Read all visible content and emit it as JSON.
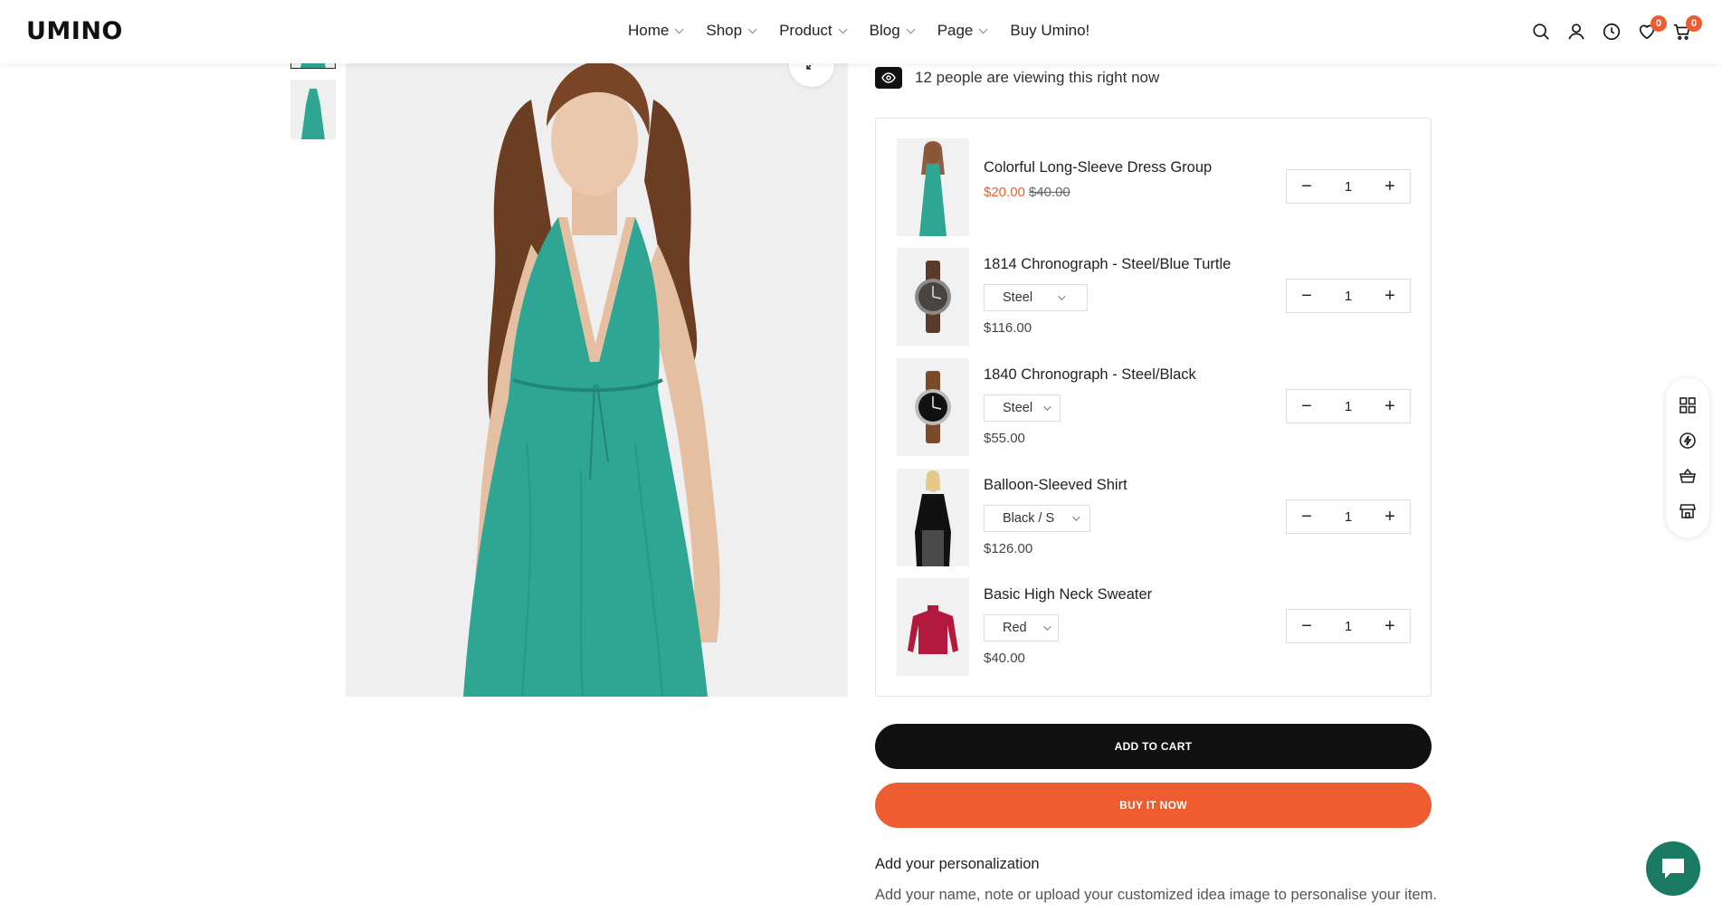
{
  "header": {
    "logo": "UMINO",
    "nav": [
      {
        "label": "Home",
        "dropdown": true
      },
      {
        "label": "Shop",
        "dropdown": true
      },
      {
        "label": "Product",
        "dropdown": true
      },
      {
        "label": "Blog",
        "dropdown": true
      },
      {
        "label": "Page",
        "dropdown": true
      },
      {
        "label": "Buy Umino!",
        "dropdown": false
      }
    ],
    "icons": [
      "search-icon",
      "account-icon",
      "history-icon",
      "wishlist-icon",
      "cart-icon"
    ],
    "wishlist_count": "0",
    "cart_count": "0"
  },
  "gallery": {
    "thumbnails": [
      "dress-front",
      "dress-back"
    ],
    "active_thumbnail": 0
  },
  "product": {
    "viewers_text": "12 people are viewing this right now"
  },
  "bundle": {
    "items": [
      {
        "name": "Colorful Long-Sleeve Dress Group",
        "sale_price": "$20.00",
        "old_price": "$40.00",
        "variant": null,
        "qty": "1",
        "image": "dress"
      },
      {
        "name": "1814 Chronograph - Steel/Blue Turtle",
        "price": "$116.00",
        "variant": "Steel",
        "qty": "1",
        "image": "watch-brown"
      },
      {
        "name": "1840 Chronograph - Steel/Black",
        "price": "$55.00",
        "variant": "Steel",
        "qty": "1",
        "image": "watch-black"
      },
      {
        "name": "Balloon-Sleeved Shirt",
        "price": "$126.00",
        "variant": "Black / S",
        "qty": "1",
        "image": "shirt"
      },
      {
        "name": "Basic High Neck Sweater",
        "price": "$40.00",
        "variant": "Red",
        "qty": "1",
        "image": "sweater"
      }
    ]
  },
  "actions": {
    "add_to_cart": "ADD TO CART",
    "buy_now": "BUY IT NOW"
  },
  "personalization": {
    "title": "Add your personalization",
    "description": "Add your name, note or upload your customized idea image to personalise your item."
  },
  "colors": {
    "accent": "#ee5d2f",
    "dark": "#111111",
    "dress": "#2fa593",
    "chat": "#1a7a64"
  }
}
